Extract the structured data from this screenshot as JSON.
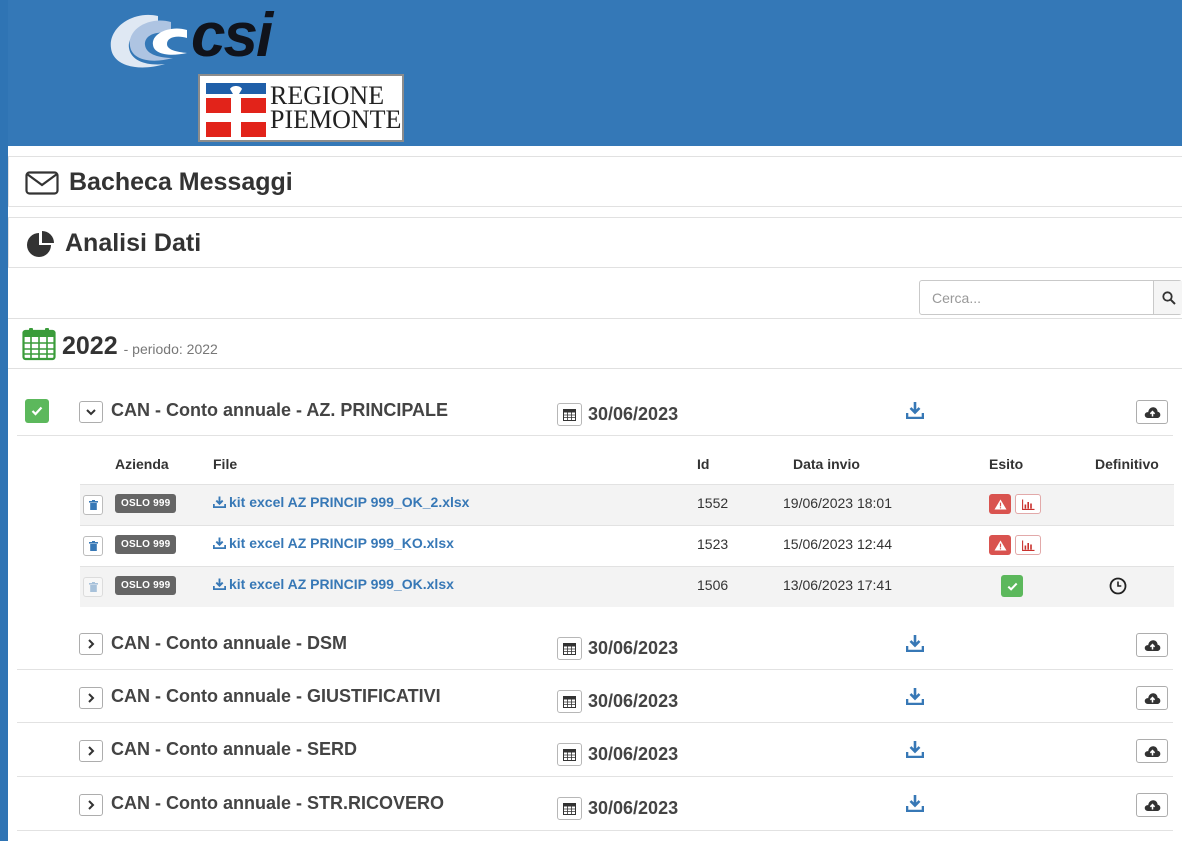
{
  "header": {
    "brand_text": "csi",
    "region_line1": "REGIONE",
    "region_line2": "PIEMONTE",
    "background_color": "#3478b7"
  },
  "panels": {
    "messages_title": "Bacheca Messaggi",
    "messages_icon": "envelope-icon",
    "analysis_title": "Analisi Dati",
    "analysis_icon": "pie-chart-icon"
  },
  "search": {
    "placeholder": "Cerca...",
    "value": "",
    "icon": "search-icon"
  },
  "period": {
    "year": "2022",
    "label": "- periodo: 2022",
    "icon": "calendar-icon"
  },
  "table_headers": {
    "azienda": "Azienda",
    "file": "File",
    "id": "Id",
    "data_invio": "Data invio",
    "esito": "Esito",
    "definitivo": "Definitivo"
  },
  "sections": [
    {
      "label": "CAN - Conto annuale - AZ. PRINCIPALE",
      "date": "30/06/2023",
      "expanded": true,
      "completed": true
    },
    {
      "label": "CAN - Conto annuale - DSM",
      "date": "30/06/2023",
      "expanded": false
    },
    {
      "label": "CAN - Conto annuale - GIUSTIFICATIVI",
      "date": "30/06/2023",
      "expanded": false
    },
    {
      "label": "CAN - Conto annuale - SERD",
      "date": "30/06/2023",
      "expanded": false
    },
    {
      "label": "CAN - Conto annuale - STR.RICOVERO",
      "date": "30/06/2023",
      "expanded": false
    }
  ],
  "files": [
    {
      "azienda": "OSLO 999",
      "file": "kit excel AZ PRINCIP 999_OK_2.xlsx",
      "id": "1552",
      "data_invio": "19/06/2023 18:01",
      "esito": "error",
      "definitivo": ""
    },
    {
      "azienda": "OSLO 999",
      "file": "kit excel AZ PRINCIP 999_KO.xlsx",
      "id": "1523",
      "data_invio": "15/06/2023 12:44",
      "esito": "error",
      "definitivo": ""
    },
    {
      "azienda": "OSLO 999",
      "file": "kit excel AZ PRINCIP 999_OK.xlsx",
      "id": "1506",
      "data_invio": "13/06/2023 17:41",
      "esito": "ok",
      "definitivo": "pending"
    }
  ],
  "colors": {
    "primary_blue": "#3478b7",
    "link_blue": "#3778b6",
    "success_green": "#5cb85c",
    "danger_red": "#d9534f",
    "badge_gray": "#656565"
  }
}
